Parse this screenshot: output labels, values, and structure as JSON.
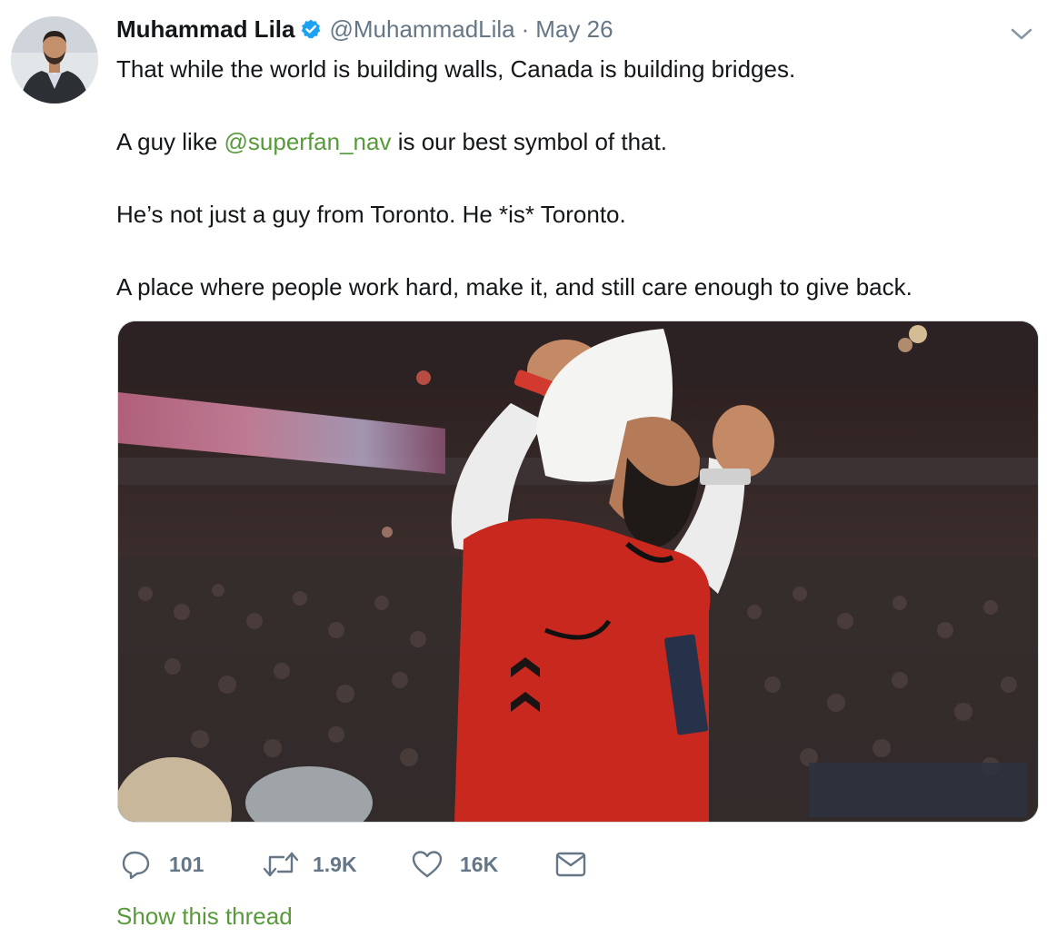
{
  "tweet": {
    "author": {
      "display_name": "Muhammad Lila",
      "handle": "@MuhammadLila",
      "verified": true
    },
    "separator": "·",
    "timestamp": "May 26",
    "body": {
      "line1": "That while the world is building walls, Canada is building bridges.",
      "line2_pre": "A guy like ",
      "line2_mention": "@superfan_nav",
      "line2_post": " is our best symbol of that.",
      "line3": "He’s not just a guy from Toronto.  He *is* Toronto.",
      "line4": "A place where people work hard, make it, and still care enough to give back."
    },
    "media": {
      "description": "Fan in white turban and red Raptors jersey cheering with raised fists in an arena"
    },
    "actions": {
      "replies": "101",
      "retweets": "1.9K",
      "likes": "16K"
    },
    "show_thread_label": "Show this thread"
  },
  "icons": {
    "reply": "speech-bubble-icon",
    "retweet": "retweet-arrows-icon",
    "like": "heart-icon",
    "dm": "envelope-icon",
    "verified": "verified-badge-icon",
    "caret": "chevron-down-icon"
  },
  "colors": {
    "accent_link": "#589a3b",
    "verified_blue": "#1da1f2",
    "secondary_text": "#657786",
    "primary_text": "#14171a"
  }
}
